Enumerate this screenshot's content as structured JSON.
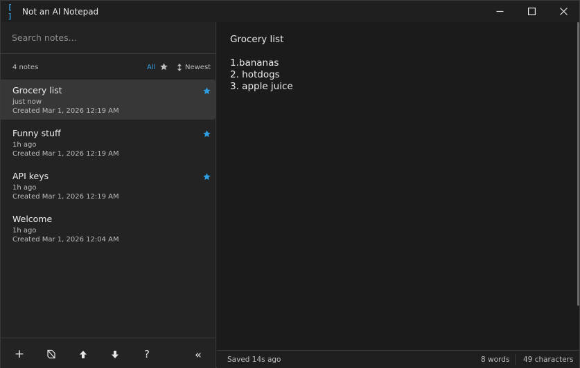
{
  "window": {
    "icon_glyph": "[ ]",
    "title": "Not an AI Notepad"
  },
  "search": {
    "placeholder": "Search notes..."
  },
  "list_header": {
    "count": "4 notes",
    "filter_all": "All",
    "sort": "Newest"
  },
  "notes": [
    {
      "title": "Grocery list",
      "updated": "just now",
      "created": "Created Mar 1, 2026 12:19 AM",
      "starred": true,
      "selected": true
    },
    {
      "title": "Funny stuff",
      "updated": "1h ago",
      "created": "Created Mar 1, 2026 12:19 AM",
      "starred": true,
      "selected": false
    },
    {
      "title": "API keys",
      "updated": "1h ago",
      "created": "Created Mar 1, 2026 12:19 AM",
      "starred": true,
      "selected": false
    },
    {
      "title": "Welcome",
      "updated": "1h ago",
      "created": "Created Mar 1, 2026 12:04 AM",
      "starred": false,
      "selected": false
    }
  ],
  "toolbar": {
    "new_glyph": "+",
    "help_glyph": "?",
    "collapse_glyph": "«"
  },
  "editor": {
    "content": "Grocery list\n\n1.bananas\n2. hotdogs\n3. apple juice"
  },
  "status": {
    "saved": "Saved 14s ago",
    "words": "8 words",
    "characters": "49 characters"
  },
  "colors": {
    "accent": "#2f9ee0",
    "background": "#1b1b1b",
    "sidebar": "#232323",
    "selected": "#373737"
  }
}
